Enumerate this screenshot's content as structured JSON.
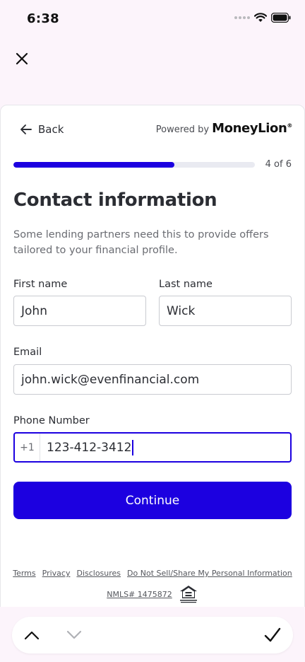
{
  "status_bar": {
    "time": "6:38"
  },
  "navigation": {
    "back_label": "Back"
  },
  "branding": {
    "powered_by": "Powered by",
    "brand_name": "MoneyLion",
    "brand_mark": "®"
  },
  "progress": {
    "label": "4 of 6",
    "fraction": 0.667
  },
  "form": {
    "title": "Contact information",
    "description": "Some lending partners need this to provide offers tailored to your financial profile.",
    "first_name": {
      "label": "First name",
      "value": "John"
    },
    "last_name": {
      "label": "Last name",
      "value": "Wick"
    },
    "email": {
      "label": "Email",
      "value": "john.wick@evenfinancial.com"
    },
    "phone": {
      "label": "Phone Number",
      "prefix": "+1",
      "value": "123-412-3412"
    },
    "continue_label": "Continue"
  },
  "footer": {
    "links": [
      "Terms",
      "Privacy",
      "Disclosures",
      "Do Not Sell/Share My Personal Information"
    ],
    "nmls": "NMLS# 1475872",
    "equal_housing_logo_text": "EQUAL HOUSING OPPORTUNITY"
  },
  "colors": {
    "accent": "#1c00e0",
    "background": "#fcf4fb",
    "text": "#2b2d33"
  },
  "icons": {
    "close": "close-icon",
    "back": "arrow-left-icon",
    "toolbar_up": "chevron-up-icon",
    "toolbar_down": "chevron-down-icon",
    "toolbar_done": "checkmark-icon"
  }
}
